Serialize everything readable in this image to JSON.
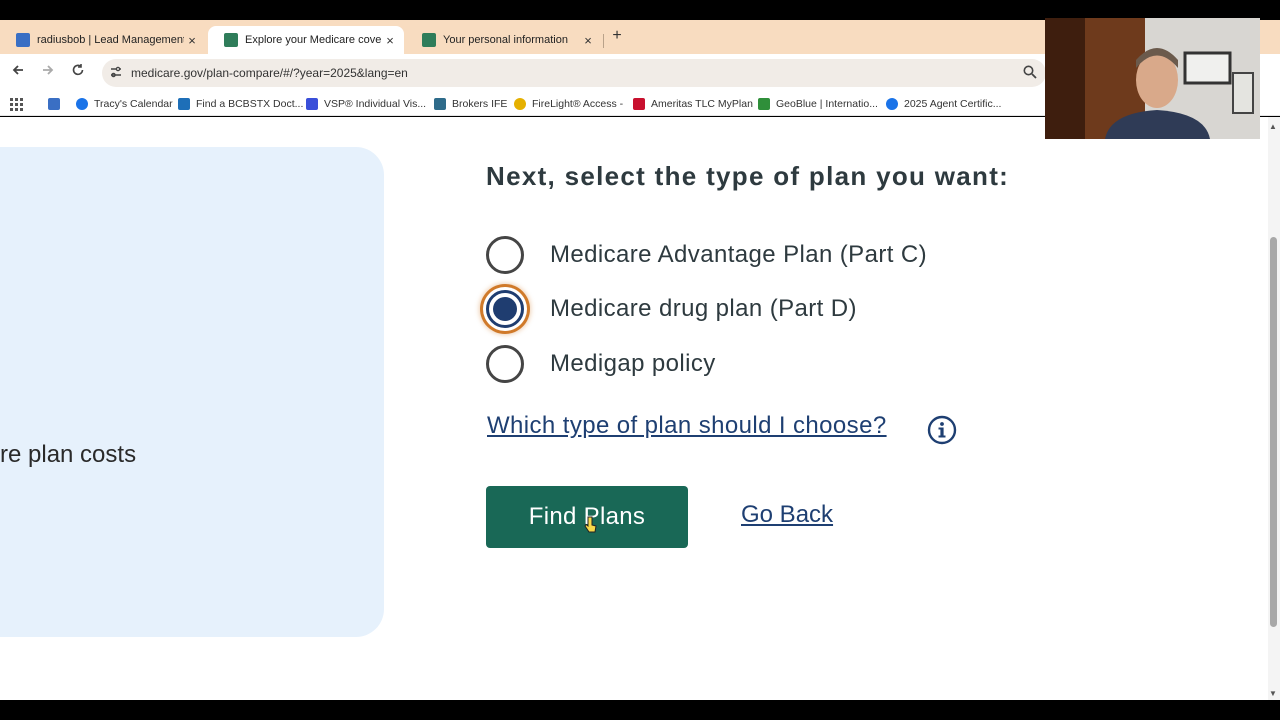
{
  "browser": {
    "tabs": [
      {
        "title": "radiusbob | Lead Management",
        "active": false
      },
      {
        "title": "Explore your Medicare coverage",
        "active": true
      },
      {
        "title": "Your personal information",
        "active": false
      }
    ],
    "close_glyph": "×",
    "new_tab_glyph": "+",
    "url": "medicare.gov/plan-compare/#/?year=2025&lang=en",
    "bookmarks": [
      {
        "label": "Tracy's Calendar",
        "color": "#1a73e8"
      },
      {
        "label": "Find a BCBSTX Doct...",
        "color": "#1e6fb8"
      },
      {
        "label": "VSP® Individual Vis...",
        "color": "#3a4fd9"
      },
      {
        "label": "Brokers IFE",
        "color": "#2e6b8a"
      },
      {
        "label": "FireLight® Access -",
        "color": "#e5b000"
      },
      {
        "label": "Ameritas TLC MyPlan",
        "color": "#c8102e"
      },
      {
        "label": "GeoBlue | Internatio...",
        "color": "#2f8f3a"
      },
      {
        "label": "2025 Agent Certific...",
        "color": "#1a73e8"
      }
    ]
  },
  "page": {
    "left_card_text": "re plan costs",
    "heading": "Next, select the type of plan you want:",
    "plan_options": [
      {
        "label": "Medicare Advantage Plan (Part C)",
        "checked": false
      },
      {
        "label": "Medicare drug plan (Part D)",
        "checked": true
      },
      {
        "label": "Medigap policy",
        "checked": false
      }
    ],
    "help_link": "Which type of plan should I choose?",
    "find_plans_button": "Find Plans",
    "go_back_link": "Go Back"
  },
  "colors": {
    "primary_button": "#196856",
    "link": "#1e3f72",
    "radio_selected": "#1f3d70",
    "focus_ring": "#d07a2a",
    "card_bg": "#e6f1fc",
    "tab_strip": "#f8dcc0"
  }
}
